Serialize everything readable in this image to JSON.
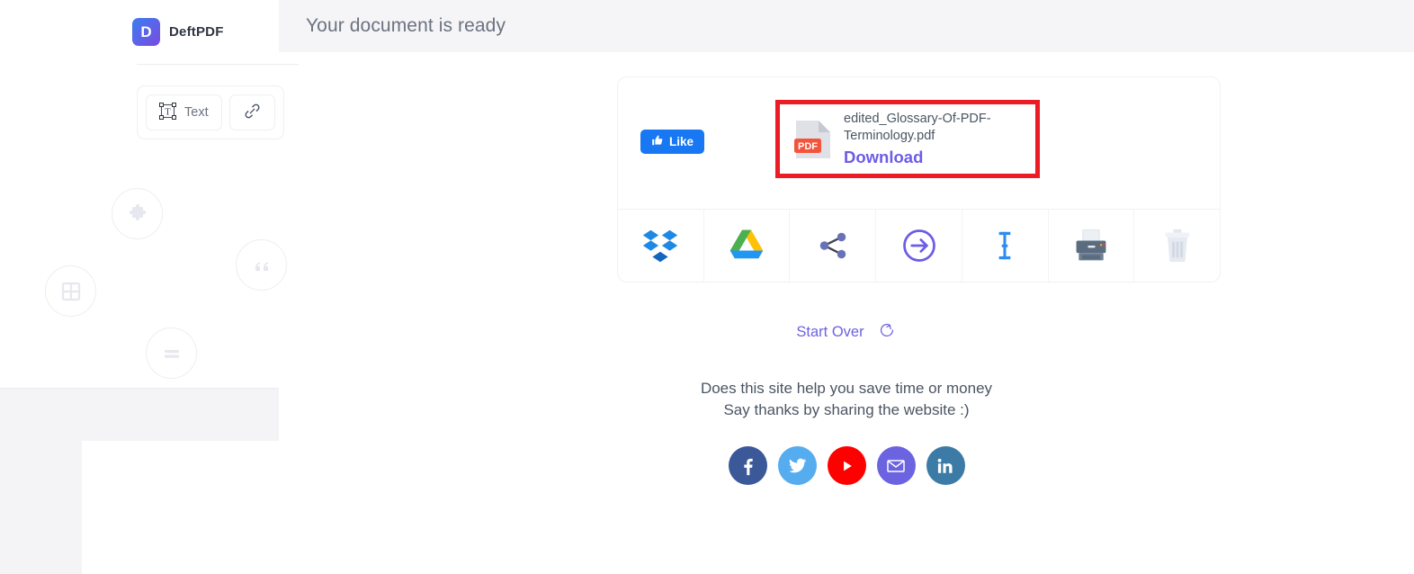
{
  "header": {
    "title": "Your document is ready"
  },
  "sidebar": {
    "brand": {
      "logo_letter": "D",
      "name": "DeftPDF"
    },
    "tools": [
      {
        "name": "text-tool",
        "label": "Text",
        "icon": "text-box-icon"
      },
      {
        "name": "link-tool",
        "label": "",
        "icon": "link-icon"
      }
    ],
    "ghost_tools": [
      {
        "name": "puzzle-icon",
        "label": ""
      },
      {
        "name": "grid-icon",
        "label": ""
      },
      {
        "name": "quote-icon",
        "label": ""
      },
      {
        "name": "shape-icon",
        "label": ""
      }
    ]
  },
  "result": {
    "like_button": {
      "label": "Like",
      "icon": "thumbs-up-icon",
      "color": "#1877f2"
    },
    "file": {
      "name": "edited_Glossary-Of-PDF-Terminology.pdf",
      "badge": "PDF",
      "download_label": "Download",
      "download_color": "#6c5ce7",
      "highlight_color": "#ec1c24"
    },
    "actions": [
      {
        "name": "save-to-dropbox",
        "icon": "dropbox-icon"
      },
      {
        "name": "save-to-google-drive",
        "icon": "google-drive-icon"
      },
      {
        "name": "share",
        "icon": "share-icon"
      },
      {
        "name": "continue",
        "icon": "arrow-circle-right-icon"
      },
      {
        "name": "rename",
        "icon": "text-cursor-icon"
      },
      {
        "name": "print",
        "icon": "printer-icon"
      },
      {
        "name": "delete",
        "icon": "trash-icon"
      }
    ]
  },
  "start_over": {
    "label": "Start Over",
    "icon": "refresh-icon",
    "color": "#6c63e0"
  },
  "share_prompt": {
    "line1": "Does this site help you save time or money",
    "line2": "Say thanks by sharing the website :)"
  },
  "social": [
    {
      "name": "facebook",
      "color": "#3b5998"
    },
    {
      "name": "twitter",
      "color": "#55acee"
    },
    {
      "name": "youtube",
      "color": "#ff0000"
    },
    {
      "name": "email",
      "color": "#6c63e0"
    },
    {
      "name": "linkedin",
      "color": "#3b7ba5"
    }
  ]
}
